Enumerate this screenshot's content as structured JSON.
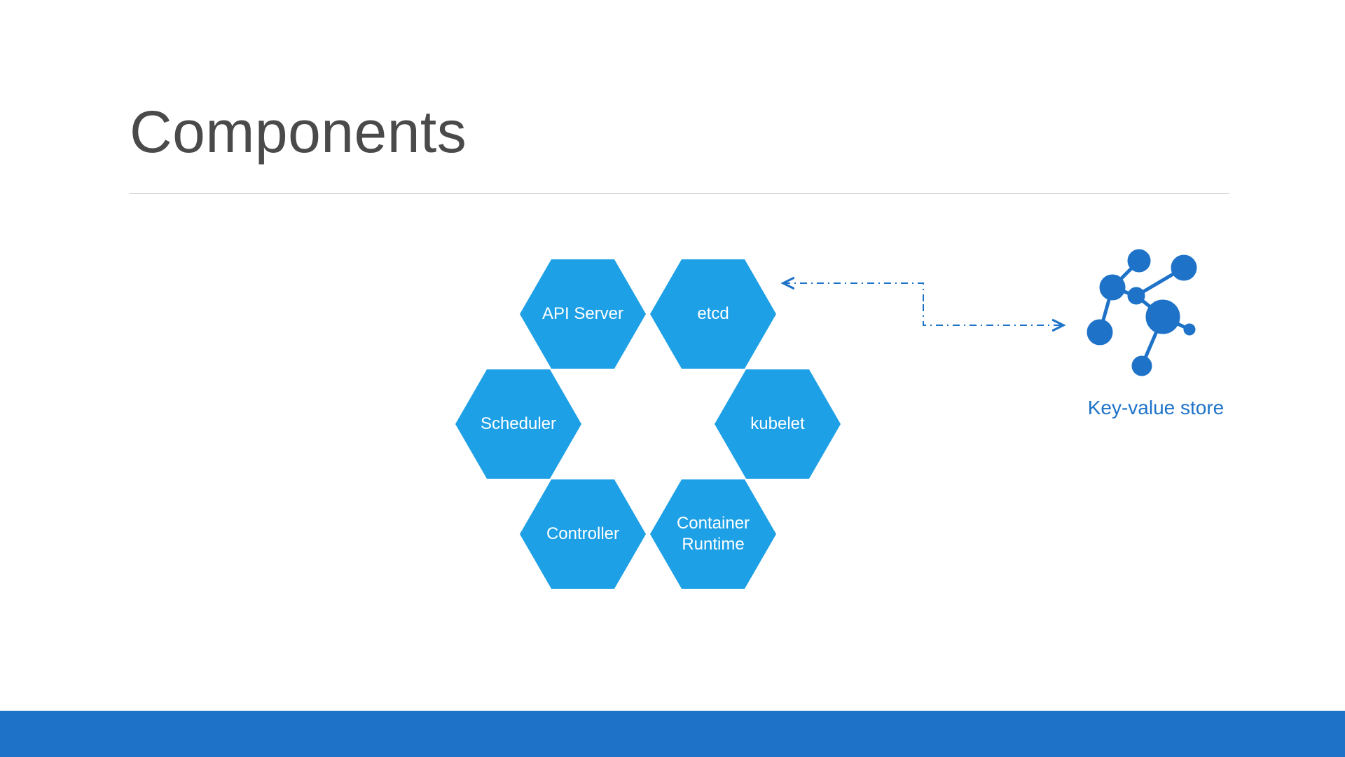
{
  "title": "Components",
  "hexes": {
    "api_server": "API Server",
    "etcd": "etcd",
    "scheduler": "Scheduler",
    "kubelet": "kubelet",
    "controller": "Controller",
    "container_runtime": "Container Runtime"
  },
  "sidebar": {
    "kv_label": "Key-value store"
  },
  "colors": {
    "hex_fill": "#1ea0e6",
    "footer": "#1e73c8",
    "title": "#4a4a4a",
    "connector": "#1e73c8",
    "graph": "#1e73c8"
  }
}
